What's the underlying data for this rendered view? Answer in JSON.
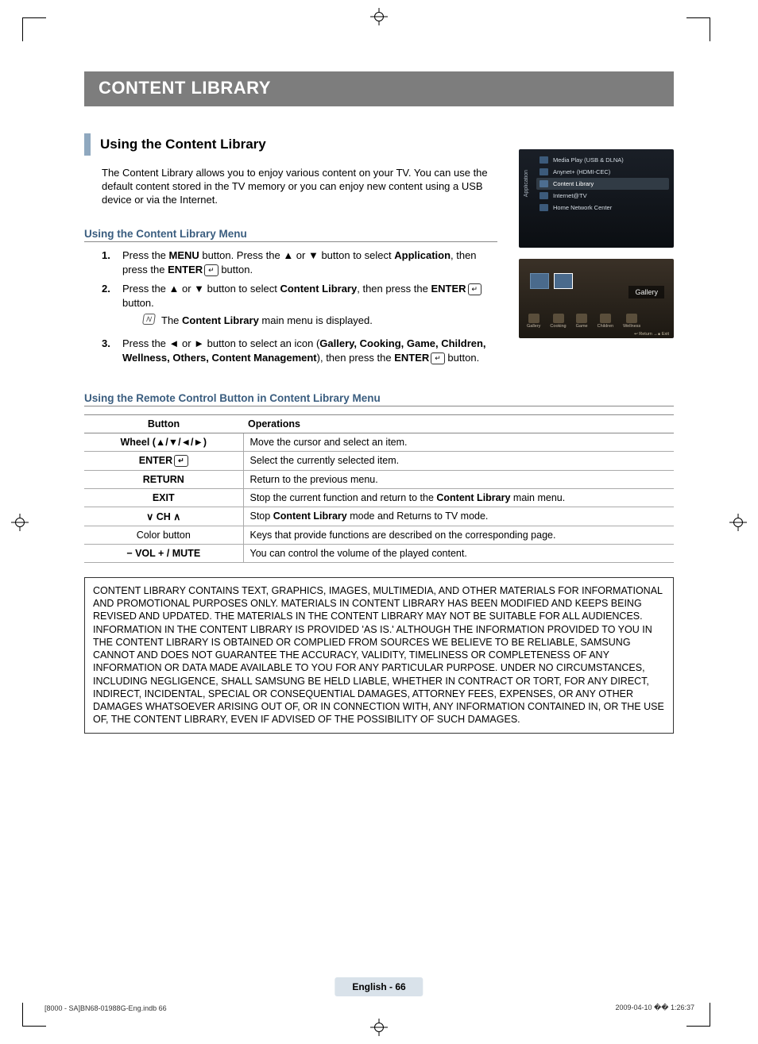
{
  "title_bar": "CONTENT LIBRARY",
  "heading_using": "Using the Content Library",
  "intro": "The Content Library allows you to enjoy various content on your TV. You can use the default content stored in the TV memory or you can enjoy new content using a USB device or via the Internet.",
  "heading_menu": "Using the Content Library Menu",
  "steps": {
    "s1_a": "Press the ",
    "s1_menu": "MENU",
    "s1_b": " button. Press the ▲ or ▼ button to select ",
    "s1_app": "Application",
    "s1_c": ", then press the ",
    "s1_enter": "ENTER",
    "s1_d": " button.",
    "s2_a": "Press the ▲ or ▼ button to select ",
    "s2_cl": "Content Library",
    "s2_b": ", then press the ",
    "s2_enter": "ENTER",
    "s2_c": " button.",
    "s2_note_a": "The ",
    "s2_note_b": "Content Library",
    "s2_note_c": " main menu is displayed.",
    "s3_a": "Press the ◄ or ► button to select an icon (",
    "s3_bold": "Gallery, Cooking, Game, Children, Wellness, Others, Content Management",
    "s3_b": "), then press the ",
    "s3_enter": "ENTER",
    "s3_c": " button."
  },
  "heading_remote": "Using the Remote Control Button in Content Library Menu",
  "table": {
    "head_button": "Button",
    "head_ops": "Operations",
    "rows": [
      {
        "btn": "Wheel (▲/▼/◄/►)",
        "op": "Move the cursor and select an item."
      },
      {
        "btn": "ENTER",
        "enter_icon": true,
        "op": "Select the currently selected item."
      },
      {
        "btn": "RETURN",
        "op": "Return to the previous menu."
      },
      {
        "btn": "EXIT",
        "op_a": "Stop the current function and return to the ",
        "op_bold": "Content Library",
        "op_b": " main menu."
      },
      {
        "btn": "∨ CH ∧",
        "op_a": "Stop ",
        "op_bold": "Content Library",
        "op_b": " mode and Returns to TV mode."
      },
      {
        "btn": "Color button",
        "bold": false,
        "op": "Keys that provide functions are described on the corresponding page."
      },
      {
        "btn": "− VOL + / MUTE",
        "op": "You can control the volume of the played content."
      }
    ]
  },
  "disclaimer_p1": "CONTENT LIBRARY CONTAINS TEXT, GRAPHICS, IMAGES, MULTIMEDIA, AND OTHER MATERIALS FOR INFORMATIONAL AND PROMOTIONAL PURPOSES ONLY. MATERIALS IN CONTENT LIBRARY HAS BEEN MODIFIED AND KEEPS BEING REVISED AND UPDATED. THE MATERIALS IN THE CONTENT LIBRARY MAY NOT BE SUITABLE FOR ALL AUDIENCES.",
  "disclaimer_p2": "INFORMATION IN THE CONTENT LIBRARY IS PROVIDED 'AS IS.' ALTHOUGH THE INFORMATION PROVIDED TO YOU IN THE CONTENT LIBRARY IS OBTAINED OR COMPLIED FROM SOURCES WE BELIEVE TO BE RELIABLE, SAMSUNG CANNOT AND DOES NOT GUARANTEE THE ACCURACY, VALIDITY, TIMELINESS OR COMPLETENESS OF ANY INFORMATION OR DATA MADE AVAILABLE TO YOU FOR ANY PARTICULAR PURPOSE. UNDER NO CIRCUMSTANCES, INCLUDING NEGLIGENCE, SHALL SAMSUNG BE HELD LIABLE, WHETHER IN CONTRACT OR TORT, FOR ANY DIRECT, INDIRECT, INCIDENTAL, SPECIAL OR CONSEQUENTIAL DAMAGES, ATTORNEY FEES, EXPENSES, OR ANY OTHER DAMAGES WHATSOEVER ARISING OUT OF, OR IN CONNECTION WITH, ANY INFORMATION CONTAINED IN, OR THE USE OF, THE CONTENT LIBRARY, EVEN IF ADVISED OF THE POSSIBILITY OF SUCH DAMAGES.",
  "footer_page": "English - 66",
  "footer_left": "[8000 - SA]BN68-01988G-Eng.indb   66",
  "footer_right": "2009-04-10   �� 1:26:37",
  "tv_menu": {
    "side": "Application",
    "items": [
      "Media Play (USB & DLNA)",
      "Anynet+ (HDMI-CEC)",
      "Content Library",
      "Internet@TV",
      "Home Network Center"
    ],
    "selected": 2
  },
  "tv_gallery": {
    "label": "Gallery",
    "icons": [
      "Gallery",
      "Cooking",
      "Game",
      "Children",
      "Wellness"
    ],
    "foot": "↩ Return   →∎ Exit"
  }
}
